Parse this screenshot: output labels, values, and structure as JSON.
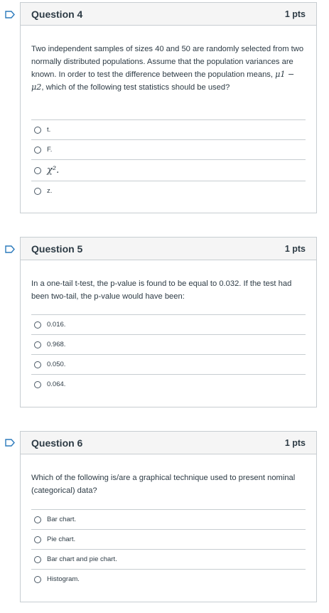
{
  "questions": [
    {
      "title": "Question 4",
      "points": "1 pts",
      "text_parts": {
        "before": "Two independent samples of sizes 40 and 50 are randomly selected from two normally distributed populations. Assume that the population variances are known. In order to test the difference between the population means, ",
        "math": "μ1 − μ2",
        "after": ", which of the following test statistics should be used?"
      },
      "answers": [
        "t.",
        "F.",
        "χ².",
        "z."
      ]
    },
    {
      "title": "Question 5",
      "points": "1 pts",
      "text": "In a one-tail t-test, the p-value is found to be equal to 0.032. If the test had been two-tail, the p-value would have been:",
      "answers": [
        "0.016.",
        "0.968.",
        "0.050.",
        "0.064."
      ]
    },
    {
      "title": "Question 6",
      "points": "1 pts",
      "text": "Which of the following is/are a graphical technique used to present nominal (categorical) data?",
      "answers": [
        "Bar chart.",
        "Pie chart.",
        "Bar chart and pie chart.",
        "Histogram."
      ]
    }
  ],
  "colors": {
    "flag": "#2b7abc",
    "border": "#c7cdd1",
    "header_bg": "#f5f5f5",
    "text": "#2d3b45"
  },
  "icons": {
    "flag": "bookmark-flag-icon",
    "radio": "radio-button-icon"
  }
}
